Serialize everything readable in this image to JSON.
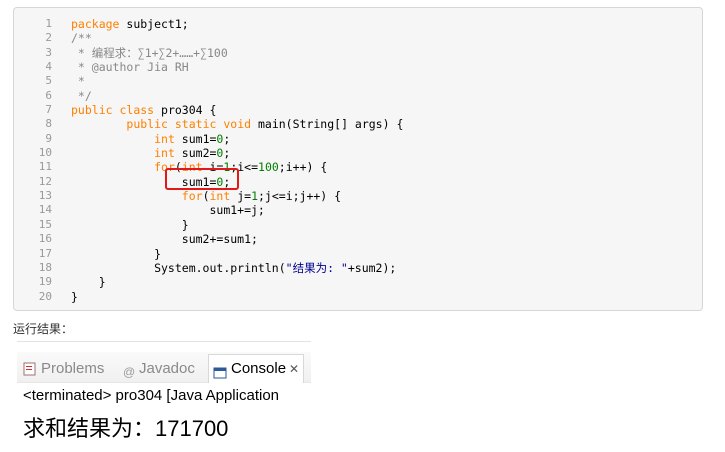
{
  "code": {
    "line_numbers": [
      "1",
      "2",
      "3",
      "4",
      "5",
      "6",
      "7",
      "8",
      "9",
      "10",
      "11",
      "12",
      "13",
      "14",
      "15",
      "16",
      "17",
      "18",
      "19",
      "20"
    ],
    "lines": [
      [
        {
          "t": "package",
          "c": "kw"
        },
        {
          "t": " subject1;",
          "c": ""
        }
      ],
      [
        {
          "t": "/**",
          "c": "cm"
        }
      ],
      [
        {
          "t": " * 编程求：∑1+∑2+……+∑100",
          "c": "cm"
        }
      ],
      [
        {
          "t": " * @author Jia RH",
          "c": "cm"
        }
      ],
      [
        {
          "t": " *",
          "c": "cm"
        }
      ],
      [
        {
          "t": " */",
          "c": "cm"
        }
      ],
      [
        {
          "t": "public",
          "c": "kw"
        },
        {
          "t": " ",
          "c": ""
        },
        {
          "t": "class",
          "c": "kw"
        },
        {
          "t": " pro304 {",
          "c": ""
        }
      ],
      [
        {
          "t": "        ",
          "c": ""
        },
        {
          "t": "public",
          "c": "kw"
        },
        {
          "t": " ",
          "c": ""
        },
        {
          "t": "static",
          "c": "kw"
        },
        {
          "t": " ",
          "c": ""
        },
        {
          "t": "void",
          "c": "kw"
        },
        {
          "t": " main(String[] args) {",
          "c": ""
        }
      ],
      [
        {
          "t": "            ",
          "c": ""
        },
        {
          "t": "int",
          "c": "kw"
        },
        {
          "t": " sum1=",
          "c": ""
        },
        {
          "t": "0",
          "c": "nm"
        },
        {
          "t": ";",
          "c": ""
        }
      ],
      [
        {
          "t": "            ",
          "c": ""
        },
        {
          "t": "int",
          "c": "kw"
        },
        {
          "t": " sum2=",
          "c": ""
        },
        {
          "t": "0",
          "c": "nm"
        },
        {
          "t": ";",
          "c": ""
        }
      ],
      [
        {
          "t": "            ",
          "c": ""
        },
        {
          "t": "for",
          "c": "kw"
        },
        {
          "t": "(",
          "c": ""
        },
        {
          "t": "int",
          "c": "kw"
        },
        {
          "t": " i=",
          "c": ""
        },
        {
          "t": "1",
          "c": "nm"
        },
        {
          "t": ";i<=",
          "c": ""
        },
        {
          "t": "100",
          "c": "nm"
        },
        {
          "t": ";i++) {",
          "c": ""
        }
      ],
      [
        {
          "t": "                sum1=",
          "c": ""
        },
        {
          "t": "0",
          "c": "nm"
        },
        {
          "t": ";",
          "c": ""
        }
      ],
      [
        {
          "t": "                ",
          "c": ""
        },
        {
          "t": "for",
          "c": "kw"
        },
        {
          "t": "(",
          "c": ""
        },
        {
          "t": "int",
          "c": "kw"
        },
        {
          "t": " j=",
          "c": ""
        },
        {
          "t": "1",
          "c": "nm"
        },
        {
          "t": ";j<=i;j++) {",
          "c": ""
        }
      ],
      [
        {
          "t": "                    sum1+=j;",
          "c": ""
        }
      ],
      [
        {
          "t": "                }",
          "c": ""
        }
      ],
      [
        {
          "t": "                sum2+=sum1;",
          "c": ""
        }
      ],
      [
        {
          "t": "            }",
          "c": ""
        }
      ],
      [
        {
          "t": "            System.out.println(",
          "c": ""
        },
        {
          "t": "\"结果为: \"",
          "c": "str"
        },
        {
          "t": "+sum2);",
          "c": ""
        }
      ],
      [
        {
          "t": "    }",
          "c": ""
        }
      ],
      [
        {
          "t": "}",
          "c": ""
        }
      ]
    ]
  },
  "result_label": "运行结果：",
  "console": {
    "tabs": [
      {
        "label": "Problems",
        "icon": "problems-icon",
        "active": false
      },
      {
        "label": "Javadoc",
        "icon": "javadoc-icon",
        "active": false
      },
      {
        "label": "Console",
        "icon": "console-icon",
        "active": true
      }
    ],
    "terminated_text": "<terminated> pro304 [Java Application",
    "output_text": "求和结果为：171700"
  },
  "colors": {
    "keyword": "#ff7f00",
    "comment": "#888888",
    "number": "#008000",
    "string": "#00008b",
    "highlight": "#e0191b"
  }
}
